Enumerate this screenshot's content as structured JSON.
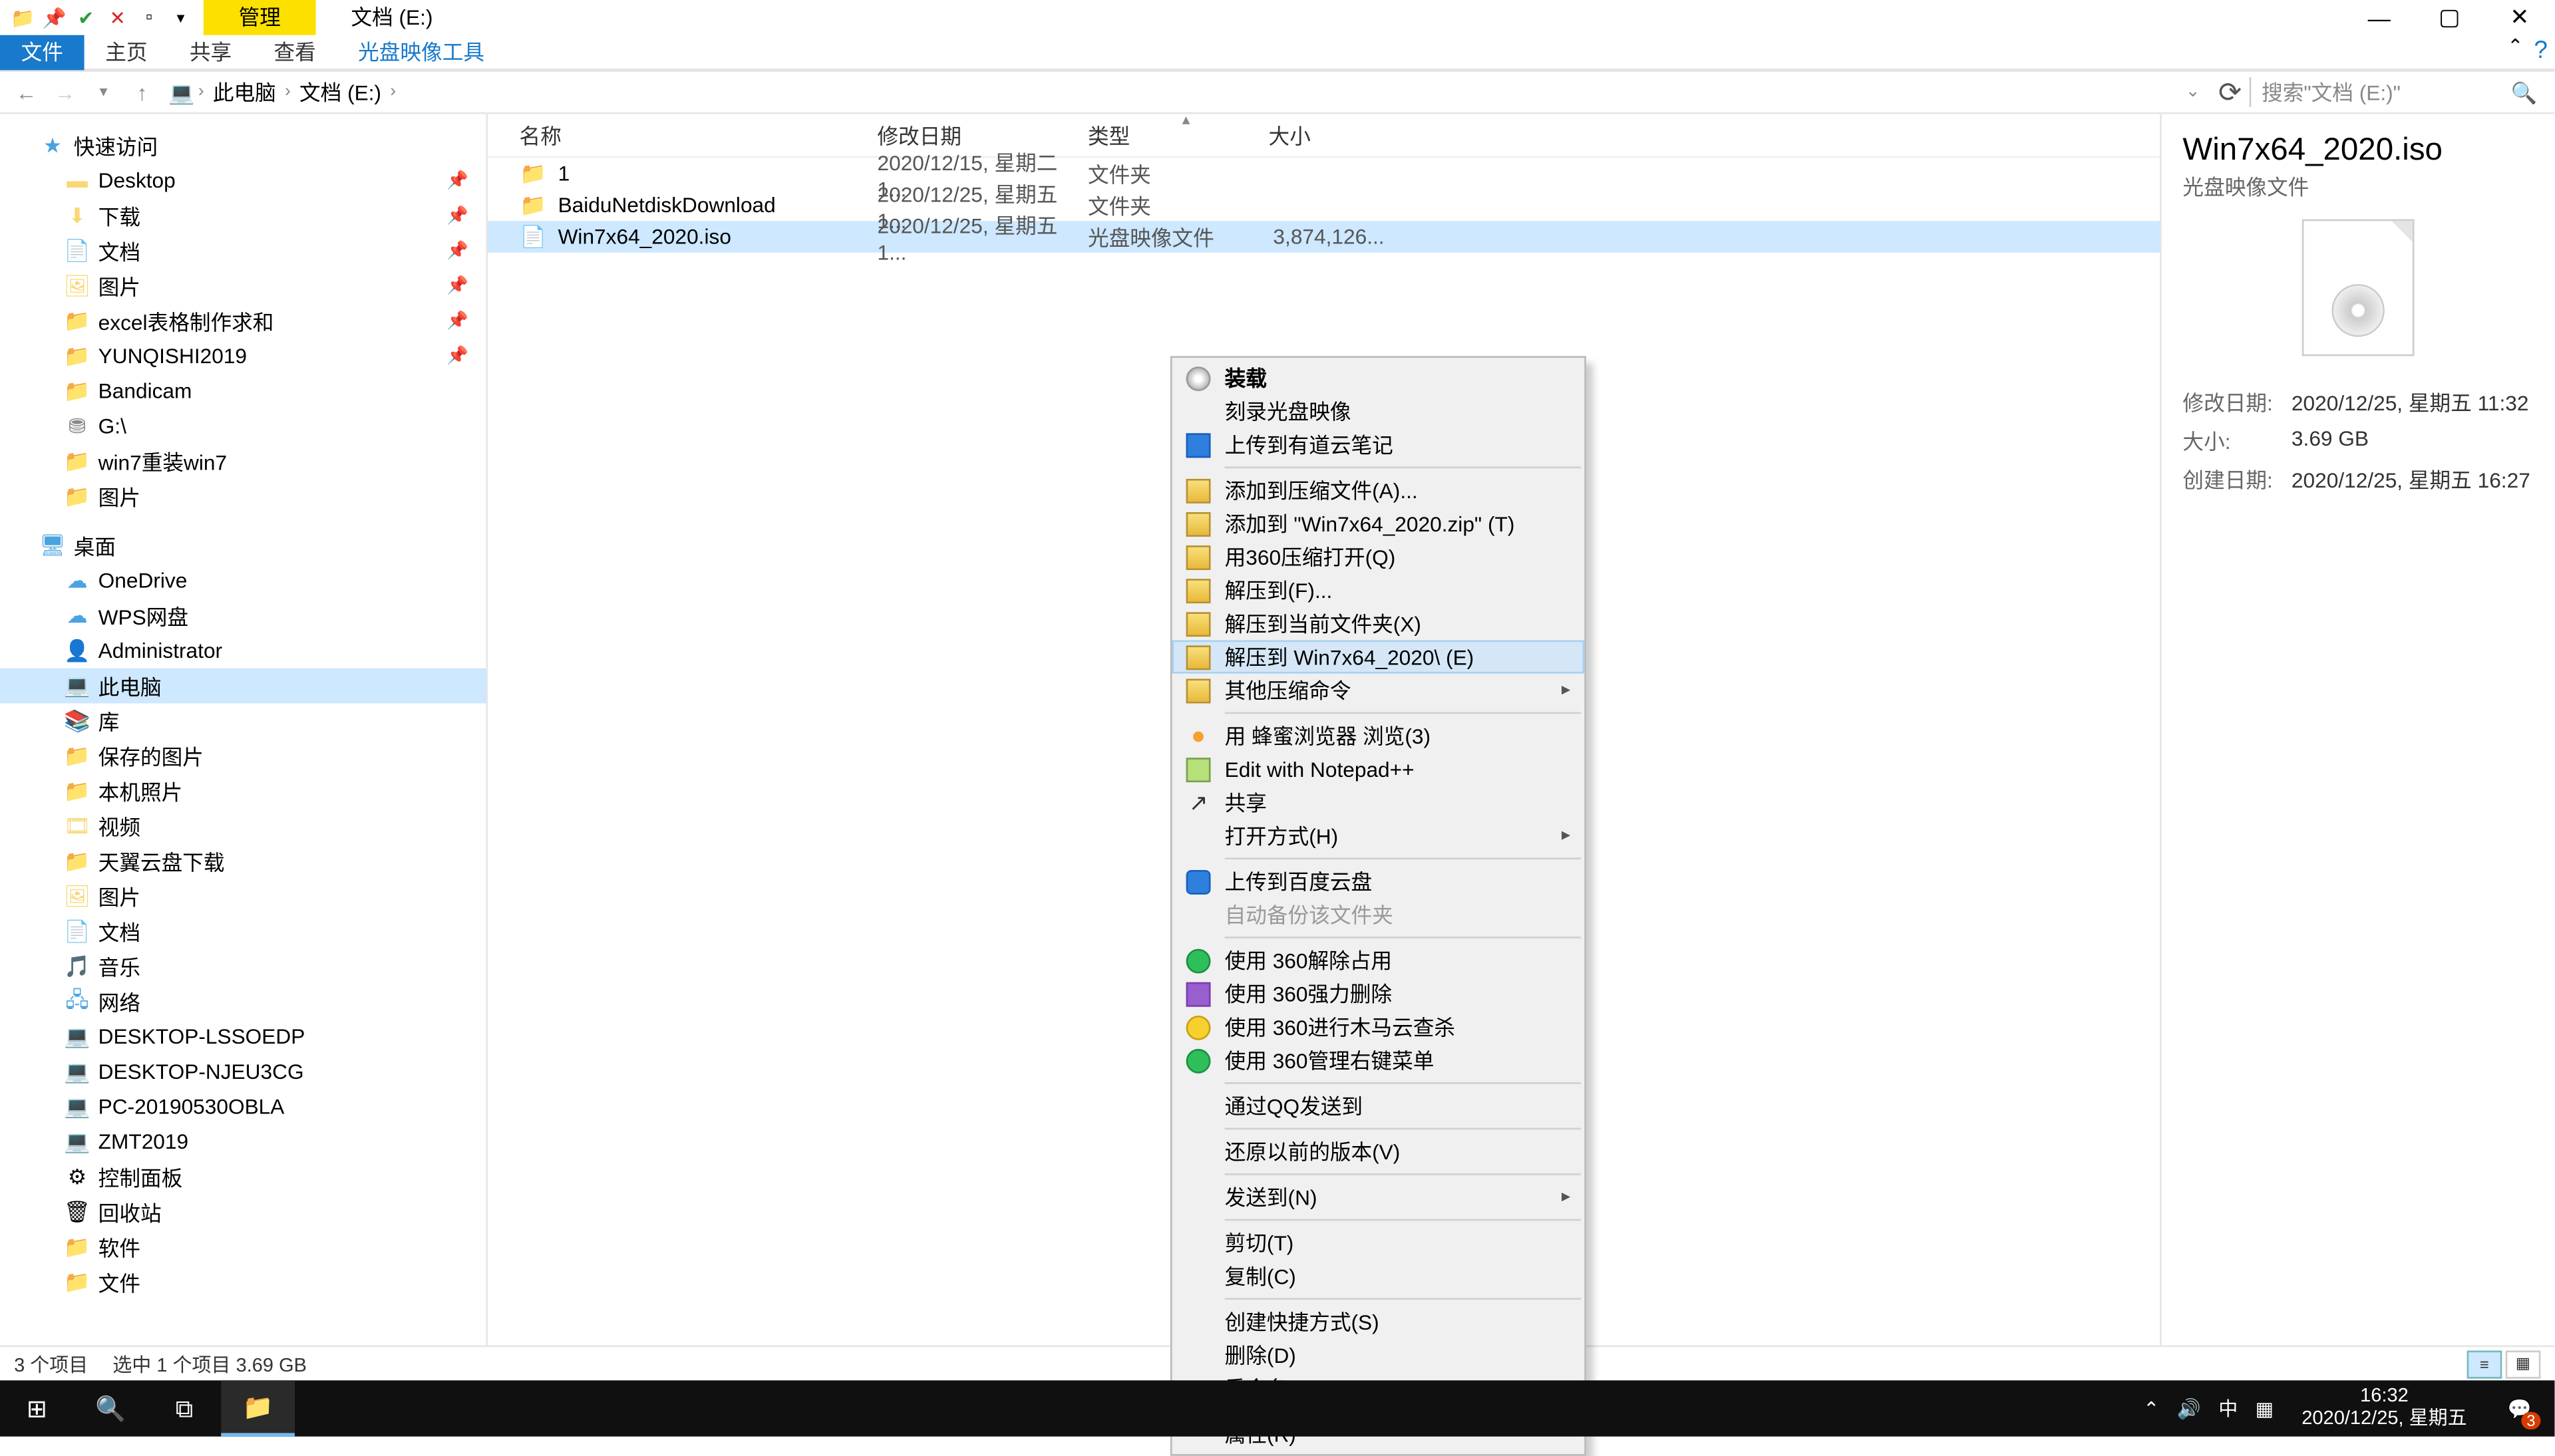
{
  "window": {
    "context_tab": "管理",
    "title": "文档 (E:)",
    "ribbon_tabs": [
      "文件",
      "主页",
      "共享",
      "查看"
    ],
    "tool_tab": "光盘映像工具"
  },
  "address": {
    "crumbs": [
      "此电脑",
      "文档 (E:)"
    ],
    "search_placeholder": "搜索\"文档 (E:)\""
  },
  "nav": {
    "quick": "快速访问",
    "quick_items": [
      "Desktop",
      "下载",
      "文档",
      "图片",
      "excel表格制作求和",
      "YUNQISHI2019",
      "Bandicam",
      "G:\\",
      "win7重装win7",
      "图片"
    ],
    "desktop": "桌面",
    "desktop_items": [
      "OneDrive",
      "WPS网盘",
      "Administrator",
      "此电脑",
      "库"
    ],
    "lib_items": [
      "保存的图片",
      "本机照片",
      "视频",
      "天翼云盘下载",
      "图片",
      "文档",
      "音乐"
    ],
    "network": "网络",
    "net_items": [
      "DESKTOP-LSSOEDP",
      "DESKTOP-NJEU3CG",
      "PC-20190530OBLA",
      "ZMT2019"
    ],
    "extra": [
      "控制面板",
      "回收站",
      "软件",
      "文件"
    ]
  },
  "columns": {
    "name": "名称",
    "mod": "修改日期",
    "type": "类型",
    "size": "大小"
  },
  "files": [
    {
      "name": "1",
      "mod": "2020/12/15, 星期二 1...",
      "type": "文件夹",
      "size": "",
      "icon": "folder"
    },
    {
      "name": "BaiduNetdiskDownload",
      "mod": "2020/12/25, 星期五 1...",
      "type": "文件夹",
      "size": "",
      "icon": "folder"
    },
    {
      "name": "Win7x64_2020.iso",
      "mod": "2020/12/25, 星期五 1...",
      "type": "光盘映像文件",
      "size": "3,874,126...",
      "icon": "iso",
      "selected": true
    }
  ],
  "details": {
    "title": "Win7x64_2020.iso",
    "subtitle": "光盘映像文件",
    "rows": [
      {
        "label": "修改日期:",
        "value": "2020/12/25, 星期五 11:32"
      },
      {
        "label": "大小:",
        "value": "3.69 GB"
      },
      {
        "label": "创建日期:",
        "value": "2020/12/25, 星期五 16:27"
      }
    ]
  },
  "status": {
    "count": "3 个项目",
    "sel": "选中 1 个项目  3.69 GB"
  },
  "context_menu": [
    {
      "label": "装载",
      "icon": "cd",
      "bold": true
    },
    {
      "label": "刻录光盘映像"
    },
    {
      "label": "上传到有道云笔记",
      "icon": "blue"
    },
    {
      "sep": true
    },
    {
      "label": "添加到压缩文件(A)...",
      "icon": "zip"
    },
    {
      "label": "添加到 \"Win7x64_2020.zip\" (T)",
      "icon": "zip"
    },
    {
      "label": "用360压缩打开(Q)",
      "icon": "zip"
    },
    {
      "label": "解压到(F)...",
      "icon": "zip"
    },
    {
      "label": "解压到当前文件夹(X)",
      "icon": "zip"
    },
    {
      "label": "解压到 Win7x64_2020\\ (E)",
      "icon": "zip",
      "hover": true
    },
    {
      "label": "其他压缩命令",
      "icon": "zip",
      "submenu": true
    },
    {
      "sep": true
    },
    {
      "label": "用 蜂蜜浏览器 浏览(3)",
      "icon": "bee"
    },
    {
      "label": "Edit with Notepad++",
      "icon": "npp"
    },
    {
      "label": "共享",
      "icon": "share"
    },
    {
      "label": "打开方式(H)",
      "submenu": true
    },
    {
      "sep": true
    },
    {
      "label": "上传到百度云盘",
      "icon": "cloud"
    },
    {
      "label": "自动备份该文件夹",
      "disabled": true
    },
    {
      "sep": true
    },
    {
      "label": "使用 360解除占用",
      "icon": "360"
    },
    {
      "label": "使用 360强力删除",
      "icon": "purple"
    },
    {
      "label": "使用 360进行木马云查杀",
      "icon": "360y"
    },
    {
      "label": "使用 360管理右键菜单",
      "icon": "360"
    },
    {
      "sep": true
    },
    {
      "label": "通过QQ发送到"
    },
    {
      "sep": true
    },
    {
      "label": "还原以前的版本(V)"
    },
    {
      "sep": true
    },
    {
      "label": "发送到(N)",
      "submenu": true
    },
    {
      "sep": true
    },
    {
      "label": "剪切(T)"
    },
    {
      "label": "复制(C)"
    },
    {
      "sep": true
    },
    {
      "label": "创建快捷方式(S)"
    },
    {
      "label": "删除(D)"
    },
    {
      "label": "重命名(M)"
    },
    {
      "sep": true
    },
    {
      "label": "属性(R)"
    }
  ],
  "taskbar": {
    "time": "16:32",
    "date": "2020/12/25, 星期五",
    "ime": "中",
    "notif_count": "3"
  }
}
